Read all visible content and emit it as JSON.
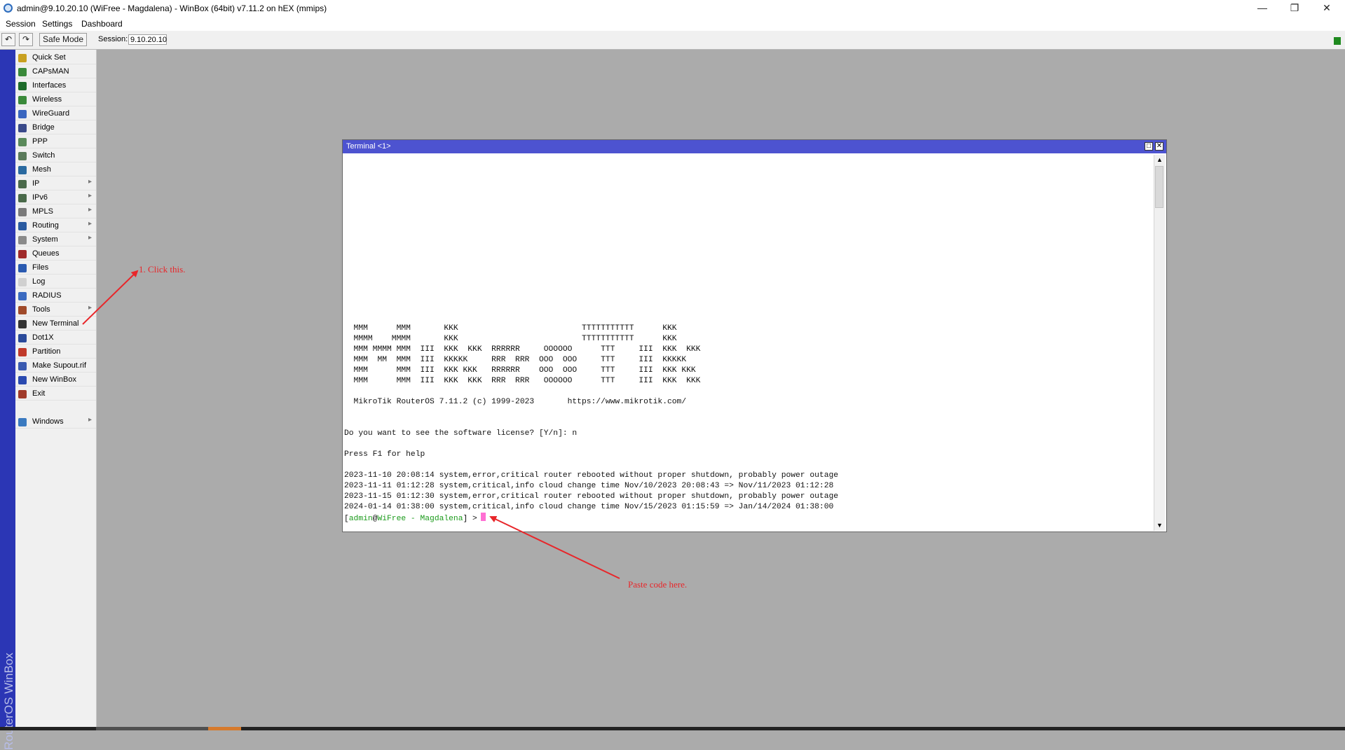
{
  "window": {
    "title": "admin@9.10.20.10 (WiFree - Magdalena) - WinBox (64bit) v7.11.2 on hEX (mmips)",
    "controls": {
      "minimize": "—",
      "restore": "❐",
      "close": "✕"
    }
  },
  "menubar": {
    "items": [
      "Session",
      "Settings",
      "Dashboard"
    ]
  },
  "toolbar": {
    "undo_icon": "↶",
    "redo_icon": "↷",
    "safe_mode_label": "Safe Mode",
    "session_label": "Session:",
    "session_value": "9.10.20.10",
    "status_color": "#1f8a1f"
  },
  "brand": {
    "text": "RouterOS WinBox"
  },
  "left_menu": {
    "items": [
      {
        "label": "Quick Set",
        "icon": "quick-set-icon",
        "color": "#c8a020",
        "submenu": false
      },
      {
        "label": "CAPsMAN",
        "icon": "capsman-icon",
        "color": "#3a8a3a",
        "submenu": false
      },
      {
        "label": "Interfaces",
        "icon": "interfaces-icon",
        "color": "#1d6b2a",
        "submenu": false
      },
      {
        "label": "Wireless",
        "icon": "wireless-icon",
        "color": "#3a8a3a",
        "submenu": false
      },
      {
        "label": "WireGuard",
        "icon": "wireguard-icon",
        "color": "#3a66c0",
        "submenu": false
      },
      {
        "label": "Bridge",
        "icon": "bridge-icon",
        "color": "#3a4a8a",
        "submenu": false
      },
      {
        "label": "PPP",
        "icon": "ppp-icon",
        "color": "#5a8a5a",
        "submenu": false
      },
      {
        "label": "Switch",
        "icon": "switch-icon",
        "color": "#5a7a5a",
        "submenu": false
      },
      {
        "label": "Mesh",
        "icon": "mesh-icon",
        "color": "#2a6aa0",
        "submenu": false
      },
      {
        "label": "IP",
        "icon": "ip-icon",
        "color": "#4a6a4a",
        "submenu": true
      },
      {
        "label": "IPv6",
        "icon": "ipv6-icon",
        "color": "#4a6a4a",
        "submenu": true
      },
      {
        "label": "MPLS",
        "icon": "mpls-icon",
        "color": "#7a7a7a",
        "submenu": true
      },
      {
        "label": "Routing",
        "icon": "routing-icon",
        "color": "#2a5aa0",
        "submenu": true
      },
      {
        "label": "System",
        "icon": "system-icon",
        "color": "#8a8a8a",
        "submenu": true
      },
      {
        "label": "Queues",
        "icon": "queues-icon",
        "color": "#a02a2a",
        "submenu": false
      },
      {
        "label": "Files",
        "icon": "files-icon",
        "color": "#2a5ab0",
        "submenu": false
      },
      {
        "label": "Log",
        "icon": "log-icon",
        "color": "#d0d0d0",
        "submenu": false
      },
      {
        "label": "RADIUS",
        "icon": "radius-icon",
        "color": "#3a6ac0",
        "submenu": false
      },
      {
        "label": "Tools",
        "icon": "tools-icon",
        "color": "#a04a2a",
        "submenu": true
      },
      {
        "label": "New Terminal",
        "icon": "terminal-icon",
        "color": "#333333",
        "submenu": false
      },
      {
        "label": "Dot1X",
        "icon": "dot1x-icon",
        "color": "#2a4a9a",
        "submenu": false
      },
      {
        "label": "Partition",
        "icon": "partition-icon",
        "color": "#c03a2a",
        "submenu": false
      },
      {
        "label": "Make Supout.rif",
        "icon": "supout-icon",
        "color": "#3a5ab0",
        "submenu": false
      },
      {
        "label": "New WinBox",
        "icon": "winbox-icon",
        "color": "#2a4ab0",
        "submenu": false
      },
      {
        "label": "Exit",
        "icon": "exit-icon",
        "color": "#a03a2a",
        "submenu": false
      },
      {
        "label": "Windows",
        "icon": "windows-icon",
        "color": "#3a7ac0",
        "submenu": true
      }
    ],
    "submenu_icon": "▸"
  },
  "terminal": {
    "title": "Terminal <1>",
    "restore_icon": "□",
    "close_icon": "✕",
    "scroll_up_icon": "▲",
    "scroll_down_icon": "▼",
    "lines": [
      "  MMM      MMM       KKK                          TTTTTTTTTTT      KKK",
      "  MMMM    MMMM       KKK                          TTTTTTTTTTT      KKK",
      "  MMM MMMM MMM  III  KKK  KKK  RRRRRR     OOOOOO      TTT     III  KKK  KKK",
      "  MMM  MM  MMM  III  KKKKK     RRR  RRR  OOO  OOO     TTT     III  KKKKK",
      "  MMM      MMM  III  KKK KKK   RRRRRR    OOO  OOO     TTT     III  KKK KKK",
      "  MMM      MMM  III  KKK  KKK  RRR  RRR   OOOOOO      TTT     III  KKK  KKK",
      "",
      "  MikroTik RouterOS 7.11.2 (c) 1999-2023       https://www.mikrotik.com/",
      "",
      "",
      "Do you want to see the software license? [Y/n]: n",
      "",
      "Press F1 for help",
      "",
      "2023-11-10 20:08:14 system,error,critical router rebooted without proper shutdown, probably power outage",
      "2023-11-11 01:12:28 system,critical,info cloud change time Nov/10/2023 20:08:43 => Nov/11/2023 01:12:28",
      "2023-11-15 01:12:30 system,error,critical router rebooted without proper shutdown, probably power outage",
      "2024-01-14 01:38:00 system,critical,info cloud change time Nov/15/2023 01:15:59 => Jan/14/2024 01:38:00"
    ],
    "prompt": {
      "open": "[",
      "user": "admin",
      "at": "@",
      "host": "WiFree - Magdalena",
      "close": "] >"
    }
  },
  "annotations": {
    "click": "1. Click this.",
    "paste": "Paste code here."
  }
}
